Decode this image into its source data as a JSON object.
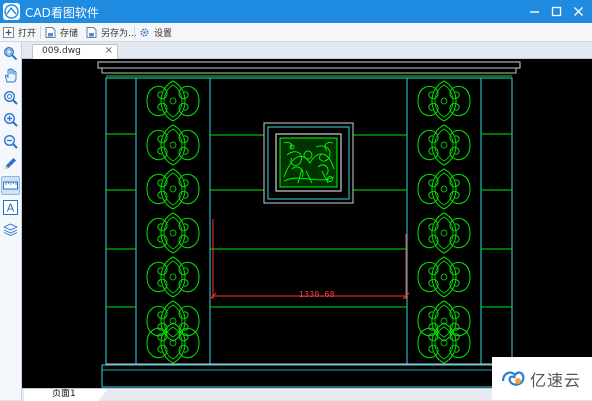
{
  "window": {
    "title": "CAD看图软件",
    "app_icon_text": "CAD",
    "controls": [
      "minimize-icon",
      "maximize-icon",
      "close-icon"
    ]
  },
  "toolbar": {
    "items": [
      {
        "label": "打开",
        "icon": "open-icon"
      },
      {
        "label": "存储",
        "icon": "save-icon"
      },
      {
        "label": "另存为...",
        "icon": "save-as-icon"
      },
      {
        "label": "设置",
        "icon": "settings-icon"
      }
    ]
  },
  "palette": {
    "tools": [
      {
        "icon": "zoom-window-icon",
        "active": false
      },
      {
        "icon": "pan-hand-icon",
        "active": false
      },
      {
        "icon": "zoom-extents-icon",
        "active": false
      },
      {
        "icon": "zoom-in-icon",
        "active": false
      },
      {
        "icon": "zoom-out-icon",
        "active": false
      },
      {
        "icon": "pencil-icon",
        "active": false
      },
      {
        "icon": "measure-icon",
        "active": true
      },
      {
        "icon": "text-icon",
        "active": false
      },
      {
        "icon": "layers-icon",
        "active": false
      }
    ],
    "text_tool_glyph": "A"
  },
  "document_tab": {
    "label": "009.dwg",
    "close": "×"
  },
  "drawing": {
    "dimension_value": "1330.68",
    "colors": {
      "background": "#000000",
      "cornice": "#ffffff",
      "pilaster": "#00e5ff",
      "ornament": "#00ff00",
      "dimension": "#ff3030"
    }
  },
  "layout_tabs": {
    "active": "页面1"
  },
  "watermark": {
    "text": "亿速云"
  }
}
